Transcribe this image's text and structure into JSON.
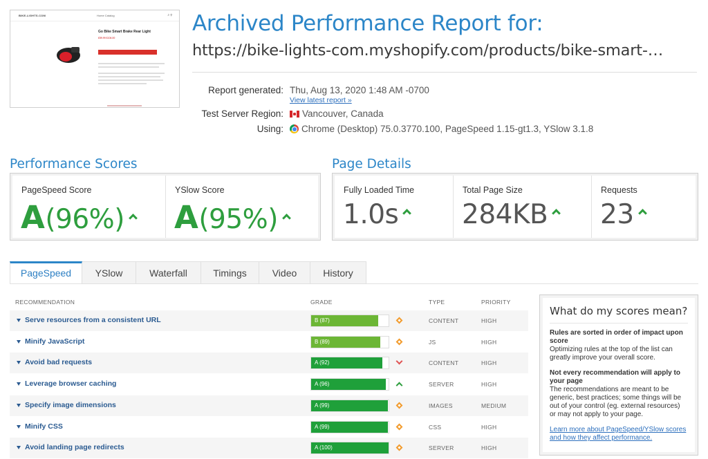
{
  "thumbnail": {
    "site_logo": "BIKE-LIGHTS.COM",
    "nav_text": "Home   Catalog",
    "product_title": "Go Bike Smart Brake Rear Light",
    "price_text": "£59.99  £104.00"
  },
  "header": {
    "title": "Archived Performance Report for:",
    "url": "https://bike-lights-com.myshopify.com/products/bike-smart-…"
  },
  "meta": {
    "report_generated_label": "Report generated:",
    "report_generated_value": "Thu, Aug 13, 2020 1:48 AM -0700",
    "view_latest": "View latest report »",
    "region_label": "Test Server Region:",
    "region_value": "Vancouver, Canada",
    "using_label": "Using:",
    "using_value": "Chrome (Desktop) 75.0.3770.100, PageSpeed 1.15-gt1.3, YSlow 3.1.8"
  },
  "performance": {
    "title": "Performance Scores",
    "pagespeed_label": "PageSpeed Score",
    "pagespeed_grade": "A",
    "pagespeed_pct": "(96%)",
    "yslow_label": "YSlow Score",
    "yslow_grade": "A",
    "yslow_pct": "(95%)"
  },
  "details": {
    "title": "Page Details",
    "loaded_label": "Fully Loaded Time",
    "loaded_value": "1.0s",
    "size_label": "Total Page Size",
    "size_value": "284KB",
    "requests_label": "Requests",
    "requests_value": "23"
  },
  "tabs": [
    "PageSpeed",
    "YSlow",
    "Waterfall",
    "Timings",
    "Video",
    "History"
  ],
  "table": {
    "headers": {
      "recommendation": "RECOMMENDATION",
      "grade": "GRADE",
      "type": "TYPE",
      "priority": "PRIORITY"
    },
    "rows": [
      {
        "name": "Serve resources from a consistent URL",
        "grade": "B (87)",
        "score": 87,
        "type": "CONTENT",
        "priority": "HIGH",
        "trend": "neutral"
      },
      {
        "name": "Minify JavaScript",
        "grade": "B (89)",
        "score": 89,
        "type": "JS",
        "priority": "HIGH",
        "trend": "neutral"
      },
      {
        "name": "Avoid bad requests",
        "grade": "A (92)",
        "score": 92,
        "type": "CONTENT",
        "priority": "HIGH",
        "trend": "down"
      },
      {
        "name": "Leverage browser caching",
        "grade": "A (96)",
        "score": 96,
        "type": "SERVER",
        "priority": "HIGH",
        "trend": "up"
      },
      {
        "name": "Specify image dimensions",
        "grade": "A (99)",
        "score": 99,
        "type": "IMAGES",
        "priority": "MEDIUM",
        "trend": "neutral"
      },
      {
        "name": "Minify CSS",
        "grade": "A (99)",
        "score": 99,
        "type": "CSS",
        "priority": "HIGH",
        "trend": "neutral"
      },
      {
        "name": "Avoid landing page redirects",
        "grade": "A (100)",
        "score": 100,
        "type": "SERVER",
        "priority": "HIGH",
        "trend": "neutral"
      }
    ]
  },
  "side": {
    "title": "What do my scores mean?",
    "p1_bold": "Rules are sorted in order of impact upon score",
    "p1": "Optimizing rules at the top of the list can greatly improve your overall score.",
    "p2_bold": "Not every recommendation will apply to your page",
    "p2": "The recommendations are meant to be generic, best practices; some things will be out of your control (eg. external resources) or may not apply to your page.",
    "link": "Learn more about PageSpeed/YSlow scores and how they affect performance."
  },
  "colors": {
    "accent": "#2c86c8",
    "grade_a": "#1fa03a",
    "grade_b": "#6cb635",
    "warn": "#f29b2d",
    "down": "#e05454"
  }
}
